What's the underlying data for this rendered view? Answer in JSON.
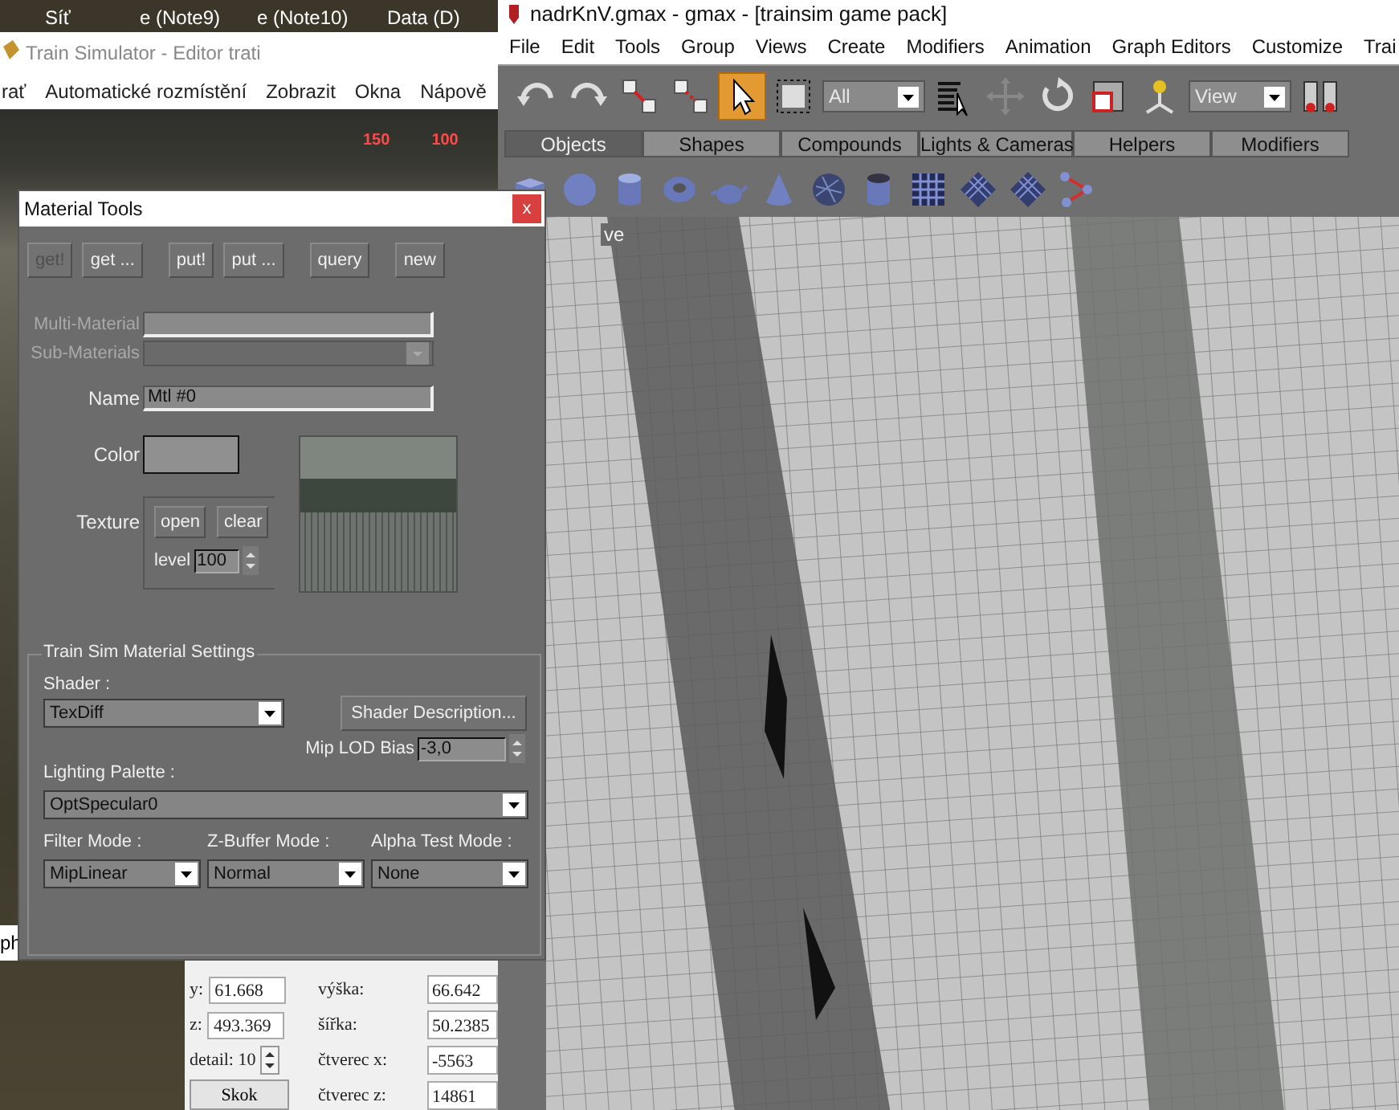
{
  "desktop": {
    "icons": [
      "Síť",
      "e (Note9)",
      "e (Note10)",
      "Data (D)"
    ]
  },
  "editor_window": {
    "title": "Train Simulator - Editor trati",
    "menu": [
      "rať",
      "Automatické rozmístění",
      "Zobrazit",
      "Okna",
      "Nápově"
    ],
    "scale_marks": [
      "150",
      "100"
    ],
    "side_label": "ph",
    "coords_left": [
      {
        "label": "y:",
        "value": "61.668"
      },
      {
        "label": "z:",
        "value": "493.369"
      }
    ],
    "detail": "detail: 10",
    "jump_button": "Skok",
    "coords_right": [
      {
        "label": "výška:",
        "value": "66.642"
      },
      {
        "label": "šířka:",
        "value": "50.2385"
      },
      {
        "label": "čtverec x:",
        "value": "-5563"
      },
      {
        "label": "čtverec z:",
        "value": "14861"
      }
    ]
  },
  "gmax_window": {
    "title": "nadrKnV.gmax - gmax - [trainsim game pack]",
    "menu": [
      "File",
      "Edit",
      "Tools",
      "Group",
      "Views",
      "Create",
      "Modifiers",
      "Animation",
      "Graph Editors",
      "Customize",
      "Trai"
    ],
    "toolbar": [
      {
        "kind": "undo",
        "selected": false
      },
      {
        "kind": "redo",
        "selected": false
      },
      {
        "kind": "link",
        "selected": false
      },
      {
        "kind": "unlink",
        "selected": false
      },
      {
        "kind": "select",
        "selected": true
      },
      {
        "kind": "region",
        "selected": false
      },
      {
        "kind": "dropdown",
        "value": "All"
      },
      {
        "kind": "list",
        "selected": false
      },
      {
        "kind": "move",
        "selected": false
      },
      {
        "kind": "rotate",
        "selected": false
      },
      {
        "kind": "scale",
        "selected": false
      },
      {
        "kind": "pivot",
        "selected": false
      },
      {
        "kind": "dropdown",
        "value": "View"
      },
      {
        "kind": "mirror",
        "selected": false
      }
    ],
    "tabs": [
      {
        "label": "Objects",
        "selected": true
      },
      {
        "label": "Shapes",
        "selected": false
      },
      {
        "label": "Compounds",
        "selected": false
      },
      {
        "label": "Lights & Cameras",
        "selected": false
      },
      {
        "label": "Helpers",
        "selected": false
      },
      {
        "label": "Modifiers",
        "selected": false
      }
    ],
    "viewport_label": "ve"
  },
  "material_tools": {
    "title": "Material Tools",
    "close": "x",
    "buttons": [
      {
        "label": "get!",
        "disabled": true
      },
      {
        "label": "get ...",
        "disabled": false
      },
      {
        "label": "put!",
        "disabled": false
      },
      {
        "label": "put ...",
        "disabled": false
      },
      {
        "label": "query",
        "disabled": false
      },
      {
        "label": "new",
        "disabled": false
      }
    ],
    "multi_material": {
      "label": "Multi-Material",
      "disabled": true
    },
    "sub_materials": {
      "label": "Sub-Materials",
      "disabled": true
    },
    "name": {
      "label": "Name",
      "value": "Mtl #0"
    },
    "color_label": "Color",
    "texture": {
      "label": "Texture",
      "open": "open",
      "clear": "clear",
      "level_label": "level",
      "level_value": "100"
    },
    "settings": {
      "title": "Train Sim Material Settings",
      "shader_label": "Shader :",
      "shader": "TexDiff",
      "shader_description": "Shader Description...",
      "mip_label": "Mip LOD Bias",
      "mip_value": "-3,0",
      "lighting_label": "Lighting Palette :",
      "lighting": "OptSpecular0",
      "modes": [
        {
          "label": "Filter Mode :",
          "value": "MipLinear"
        },
        {
          "label": "Z-Buffer Mode :",
          "value": "Normal"
        },
        {
          "label": "Alpha Test Mode :",
          "value": "None"
        }
      ]
    }
  }
}
